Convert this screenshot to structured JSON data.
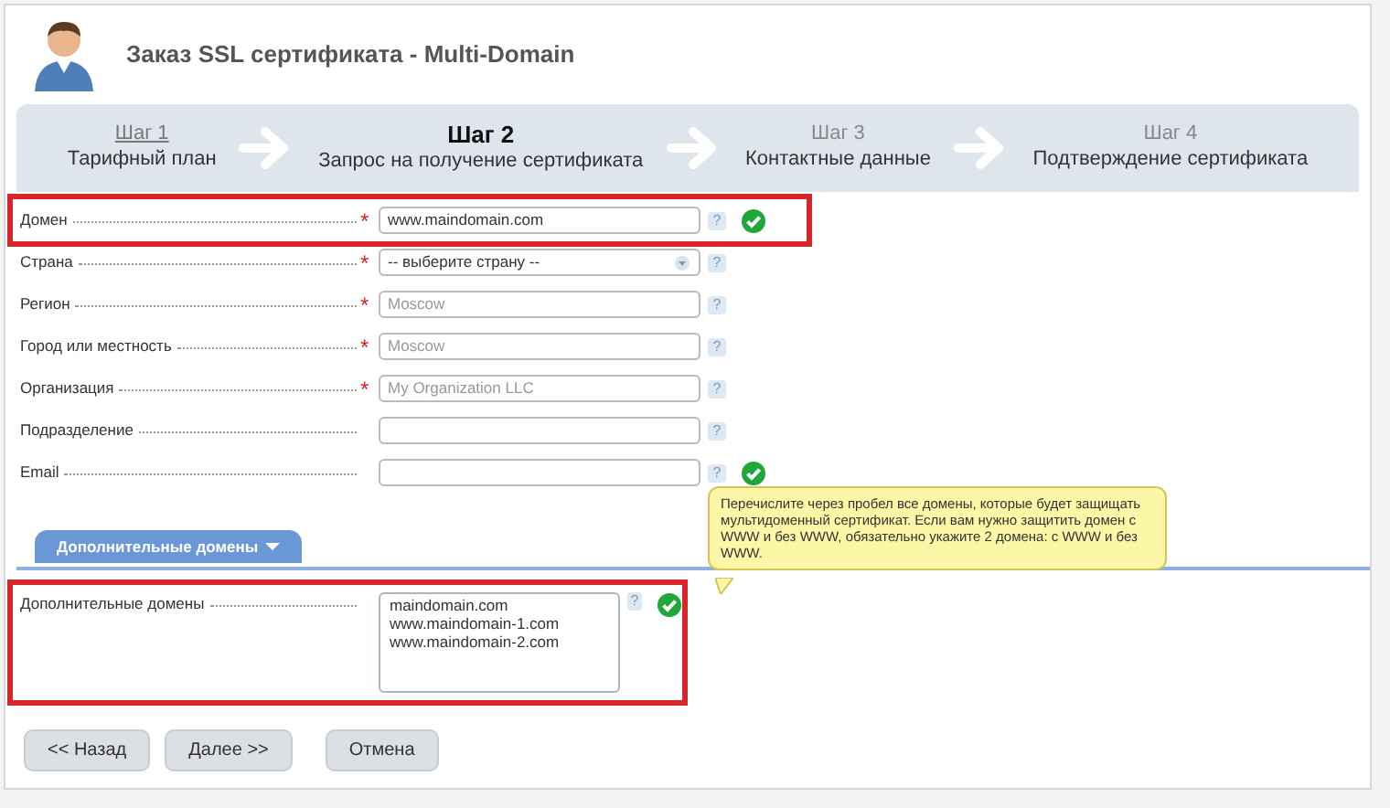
{
  "header": {
    "title": "Заказ SSL сертификата -  Multi-Domain"
  },
  "steps": [
    {
      "number": "Шаг 1",
      "label": "Тарифный план",
      "done": true,
      "selected": false
    },
    {
      "number": "Шаг 2",
      "label": "Запрос на получение сертификата",
      "done": false,
      "selected": true
    },
    {
      "number": "Шаг 3",
      "label": "Контактные данные",
      "done": false,
      "selected": false
    },
    {
      "number": "Шаг 4",
      "label": "Подтверждение сертификата",
      "done": false,
      "selected": false
    }
  ],
  "fields": [
    {
      "label": "Домен",
      "kind": "text",
      "required_mark": "*",
      "value": "www.maindomain.com",
      "help": "?",
      "valid": true,
      "highlighted": true
    },
    {
      "label": "Страна",
      "kind": "select",
      "required_mark": "*",
      "value": "-- выберите страну --",
      "help": "?",
      "valid": false,
      "highlighted": false
    },
    {
      "label": "Регион",
      "kind": "text",
      "required_mark": "*",
      "placeholder": "Moscow",
      "help": "?",
      "valid": false,
      "highlighted": false
    },
    {
      "label": "Город или местность",
      "kind": "text",
      "required_mark": "*",
      "placeholder": "Moscow",
      "help": "?",
      "valid": false,
      "highlighted": false
    },
    {
      "label": "Организация",
      "kind": "text",
      "required_mark": "*",
      "placeholder": "My Organization LLC",
      "help": "?",
      "valid": false,
      "highlighted": false
    },
    {
      "label": "Подразделение",
      "kind": "text",
      "help": "?",
      "valid": false,
      "highlighted": false
    },
    {
      "label": "Email",
      "kind": "text",
      "help": "?",
      "valid": true,
      "highlighted": false
    }
  ],
  "section": {
    "tab": "Дополнительные домены",
    "expanded": true,
    "fields": [
      {
        "label": "Дополнительные домены",
        "kind": "textarea",
        "value": "maindomain.com\nwww.maindomain-1.com\nwww.maindomain-2.com",
        "help": "?",
        "valid": true,
        "highlighted": true
      }
    ]
  },
  "tooltip": "Перечислите через пробел все домены, которые будет защищать мультидоменный сертификат. Если вам нужно защитить домен с WWW и без WWW, обязательно укажите 2 домена: с WWW и без WWW.",
  "buttons": [
    "<< Назад",
    "Далее >>",
    "Отмена"
  ]
}
